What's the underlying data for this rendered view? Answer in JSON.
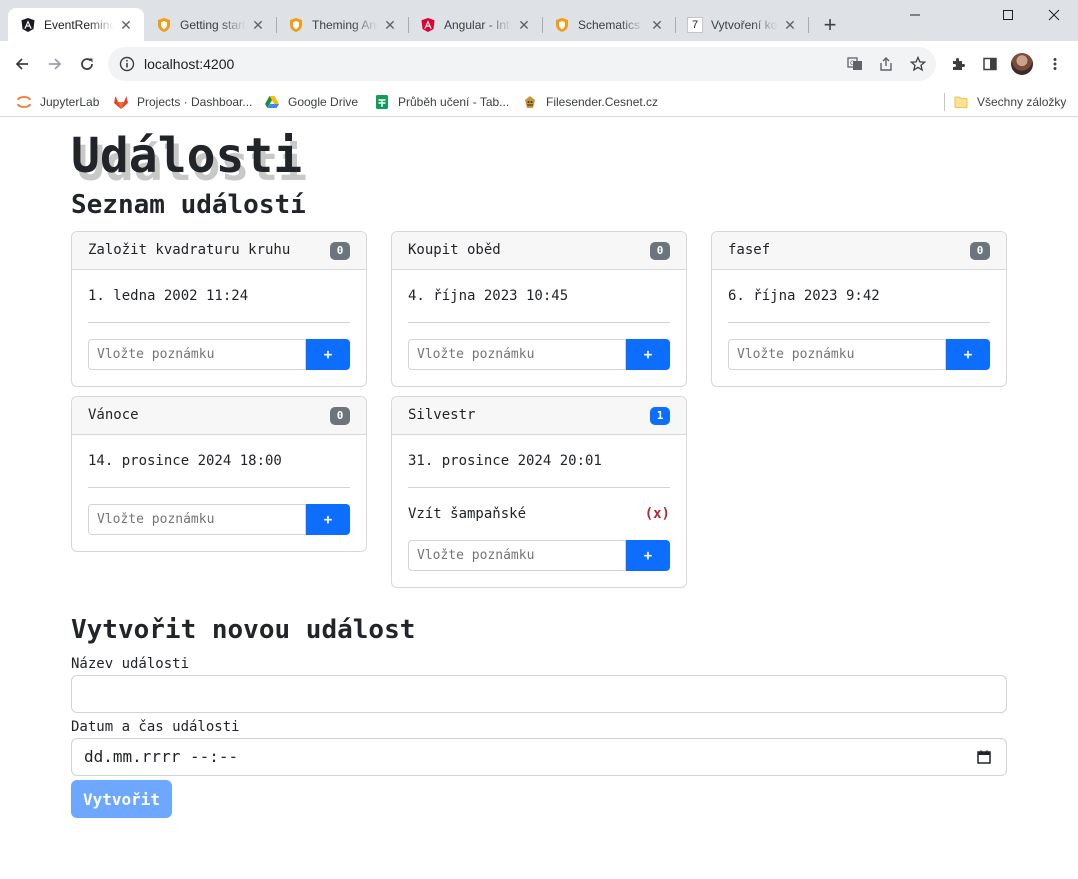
{
  "browser": {
    "tabs": [
      {
        "title": "EventReminder",
        "icon": "angular-icon"
      },
      {
        "title": "Getting started",
        "icon": "shield-icon"
      },
      {
        "title": "Theming Angular",
        "icon": "shield-icon"
      },
      {
        "title": "Angular - Introduction",
        "icon": "angular-icon"
      },
      {
        "title": "Schematics | Angular",
        "icon": "shield-icon"
      },
      {
        "title": "Vytvoření komponenty",
        "icon": "seven-icon",
        "icon_text": "7"
      }
    ],
    "url": "localhost:4200",
    "bookmarks": [
      {
        "label": "JupyterLab",
        "icon": "jupyter-icon"
      },
      {
        "label": "Projects · Dashboar...",
        "icon": "gitlab-icon"
      },
      {
        "label": "Google Drive",
        "icon": "google-drive-icon"
      },
      {
        "label": "Průběh učení - Tab...",
        "icon": "sheets-icon"
      },
      {
        "label": "Filesender.Cesnet.cz",
        "icon": "filesender-icon"
      }
    ],
    "all_bookmarks_label": "Všechny záložky"
  },
  "page": {
    "title": "Události",
    "list_heading": "Seznam událostí",
    "note_placeholder": "Vložte poznámku",
    "add_note_label": "+",
    "events": [
      {
        "name": "Založit kvadraturu kruhu",
        "count": "0",
        "date": "1. ledna 2002 11:24",
        "notes": []
      },
      {
        "name": "Koupit oběd",
        "count": "0",
        "date": "4. října 2023 10:45",
        "notes": []
      },
      {
        "name": "fasef",
        "count": "0",
        "date": "6. října 2023 9:42",
        "notes": []
      },
      {
        "name": "Vánoce",
        "count": "0",
        "date": "14. prosince 2024 18:00",
        "notes": []
      },
      {
        "name": "Silvestr",
        "count": "1",
        "date": "31. prosince 2024 20:01",
        "notes": [
          {
            "text": "Vzít šampaňské",
            "delete_label": "(x)"
          }
        ]
      }
    ],
    "form": {
      "heading": "Vytvořit novou událost",
      "name_label": "Název události",
      "name_value": "",
      "datetime_label": "Datum a čas události",
      "datetime_placeholder": "dd.mm.rrrr --:--",
      "submit_label": "Vytvořit"
    }
  },
  "colors": {
    "primary": "#0d6efd",
    "primary_disabled": "#6ea8fe",
    "badge_secondary": "#6c757d",
    "delete_text": "#b02a37"
  }
}
